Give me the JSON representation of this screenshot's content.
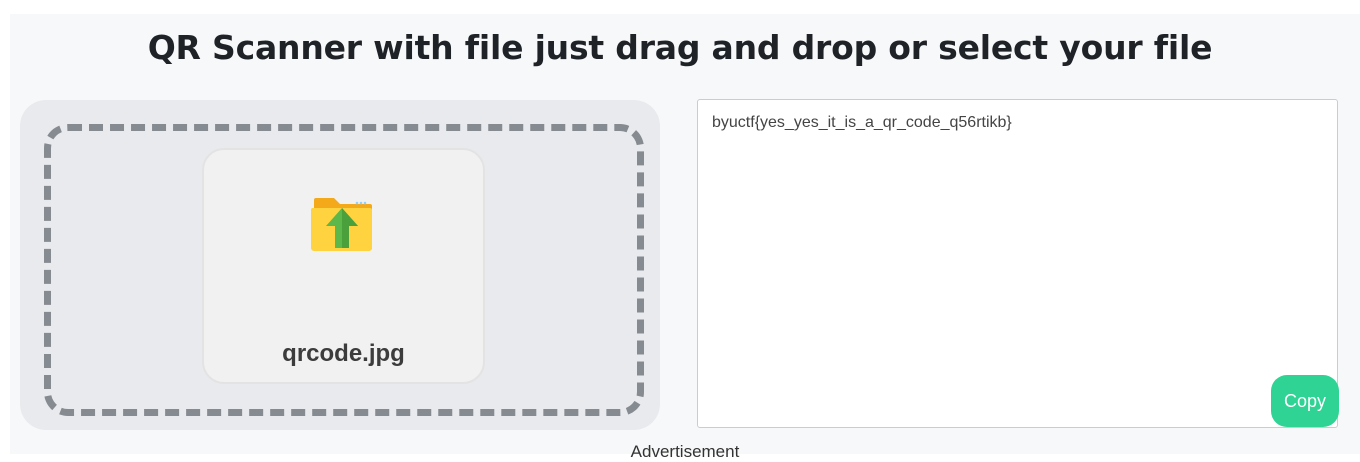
{
  "header": {
    "title": "QR Scanner with file just drag and drop or select your file"
  },
  "upload": {
    "file_name": "qrcode.jpg",
    "icon": "folder-upload-icon"
  },
  "result": {
    "text": "byuctf{yes_yes_it_is_a_qr_code_q56rtikb}"
  },
  "actions": {
    "copy_label": "Copy"
  },
  "footer": {
    "ad_label": "Advertisement"
  },
  "colors": {
    "copy_button": "#2fd393",
    "drop_border": "#868b91",
    "panel_bg": "#e8eaed"
  }
}
